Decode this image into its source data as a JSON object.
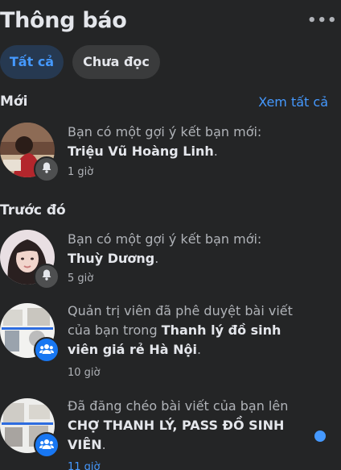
{
  "header": {
    "title": "Thông báo",
    "more_label": "•••"
  },
  "tabs": [
    {
      "label": "Tất cả",
      "active": true
    },
    {
      "label": "Chưa đọc",
      "active": false
    }
  ],
  "sections": {
    "new": {
      "title": "Mới",
      "see_all": "Xem tất cả"
    },
    "earlier": {
      "title": "Trước đó"
    }
  },
  "notifications": [
    {
      "line1": "Bạn có một gợi ý kết bạn mới:",
      "bold": "Triệu Vũ Hoàng Linh",
      "suffix": ".",
      "time": "1 giờ",
      "badge_icon": "bell-icon",
      "unread": false
    },
    {
      "line1": "Bạn có một gợi ý kết bạn mới:",
      "bold": "Thuỳ Dương",
      "suffix": ".",
      "time": "5 giờ",
      "badge_icon": "bell-icon",
      "unread": false
    },
    {
      "pre": "Quản trị viên đã phê duyệt bài viết của bạn trong ",
      "bold": "Thanh lý đồ sinh viên giá rẻ Hà Nội",
      "suffix": ".",
      "time": "10 giờ",
      "badge_icon": "group-icon",
      "unread": false
    },
    {
      "pre": "Đã đăng chéo bài viết của bạn lên ",
      "bold": "CHỢ THANH LÝ, PASS ĐỒ SINH VIÊN",
      "suffix": ".",
      "time": "11 giờ",
      "badge_icon": "group-icon",
      "unread": true
    }
  ],
  "colors": {
    "background": "#242526",
    "accent": "#4599ff",
    "active_tab_bg": "#263951",
    "inactive_tab_bg": "#3a3b3c",
    "badge_blue": "#1877f2"
  }
}
